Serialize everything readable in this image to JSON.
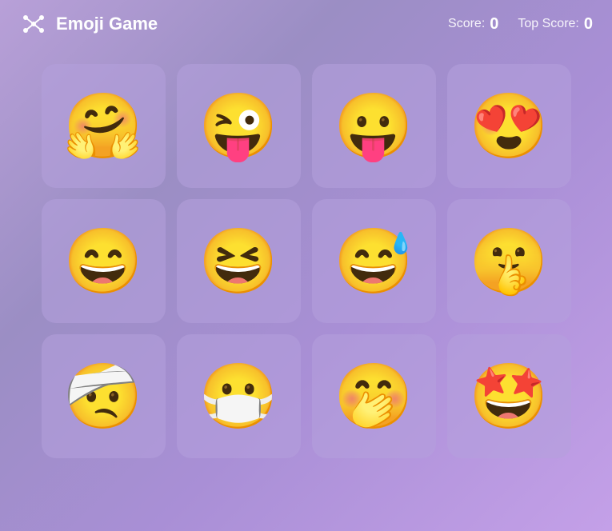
{
  "header": {
    "app_title": "Emoji Game",
    "score_label": "Score:",
    "score_value": "0",
    "top_score_label": "Top Score:",
    "top_score_value": "0"
  },
  "grid": {
    "cards": [
      {
        "id": 1,
        "emoji": "🤗",
        "name": "hugging-face"
      },
      {
        "id": 2,
        "emoji": "😜",
        "name": "winking-face-with-tongue"
      },
      {
        "id": 3,
        "emoji": "😛",
        "name": "face-with-tongue"
      },
      {
        "id": 4,
        "emoji": "😍",
        "name": "heart-eyes-face"
      },
      {
        "id": 5,
        "emoji": "😄",
        "name": "grinning-face"
      },
      {
        "id": 6,
        "emoji": "😆",
        "name": "laughing-face"
      },
      {
        "id": 7,
        "emoji": "😅",
        "name": "sweat-smile-face"
      },
      {
        "id": 8,
        "emoji": "🤫",
        "name": "shushing-face"
      },
      {
        "id": 9,
        "emoji": "🤕",
        "name": "injured-face"
      },
      {
        "id": 10,
        "emoji": "😷",
        "name": "mask-face"
      },
      {
        "id": 11,
        "emoji": "🤭",
        "name": "hand-over-mouth-face"
      },
      {
        "id": 12,
        "emoji": "🤩",
        "name": "star-struck-face"
      }
    ]
  }
}
